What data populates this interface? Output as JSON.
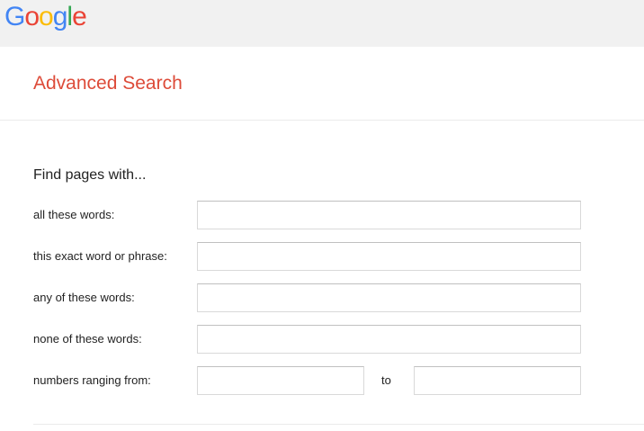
{
  "brand": {
    "logo_letters": [
      {
        "char": "G",
        "color": "#4285F4"
      },
      {
        "char": "o",
        "color": "#EA4335"
      },
      {
        "char": "o",
        "color": "#FBBC05"
      },
      {
        "char": "g",
        "color": "#4285F4"
      },
      {
        "char": "l",
        "color": "#34A853"
      },
      {
        "char": "e",
        "color": "#EA4335"
      }
    ]
  },
  "header": {
    "title": "Advanced Search",
    "title_color": "#dd4b39"
  },
  "form": {
    "section_title": "Find pages with...",
    "fields": [
      {
        "label": "all these words:",
        "value": ""
      },
      {
        "label": "this exact word or phrase:",
        "value": ""
      },
      {
        "label": "any of these words:",
        "value": ""
      },
      {
        "label": "none of these words:",
        "value": ""
      }
    ],
    "range": {
      "label": "numbers ranging from:",
      "from_value": "",
      "to_label": "to",
      "to_value": ""
    }
  }
}
